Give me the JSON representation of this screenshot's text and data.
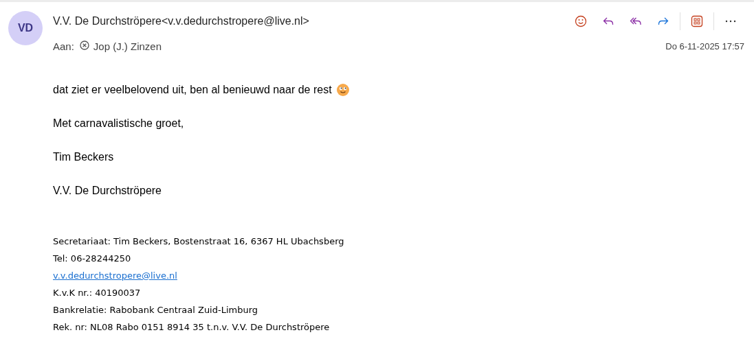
{
  "sender": {
    "initials": "VD",
    "name": "V.V. De Durchströpere<v.v.dedurchstropere@live.nl>"
  },
  "recipients": {
    "label": "Aan:",
    "names": [
      "Jop (J.) Zinzen"
    ]
  },
  "toolbar": [
    {
      "kind": "emoji"
    },
    {
      "kind": "reply"
    },
    {
      "kind": "reply-all"
    },
    {
      "kind": "forward"
    },
    {
      "kind": "divider"
    },
    {
      "kind": "apps"
    },
    {
      "kind": "divider"
    },
    {
      "kind": "more"
    }
  ],
  "date": "Do 6-11-2025 17:57",
  "body": [
    {
      "text": "dat ziet er veelbelovend uit, ben al benieuwd naar de rest",
      "emoji": true
    },
    {
      "text": "Met carnavalistische groet,",
      "emoji": false
    },
    {
      "text": "Tim Beckers",
      "emoji": false
    },
    {
      "text": "V.V. De Durchströpere",
      "emoji": false
    }
  ],
  "signature": [
    {
      "kind": "text",
      "text": "Secretariaat: Tim Beckers, Bostenstraat 16, 6367 HL Ubachsberg"
    },
    {
      "kind": "text",
      "text": "Tel: 06-28244250"
    },
    {
      "kind": "link",
      "text": "v.v.dedurchstropere@live.nl"
    },
    {
      "kind": "text",
      "text": "K.v.K nr.: 40190037"
    },
    {
      "kind": "text",
      "text": "Bankrelatie: Rabobank Centraal Zuid-Limburg"
    },
    {
      "kind": "text",
      "text": "Rek. nr: NL08 Rabo 0151 8914 35 t.n.v. V.V. De Durchströpere"
    }
  ]
}
